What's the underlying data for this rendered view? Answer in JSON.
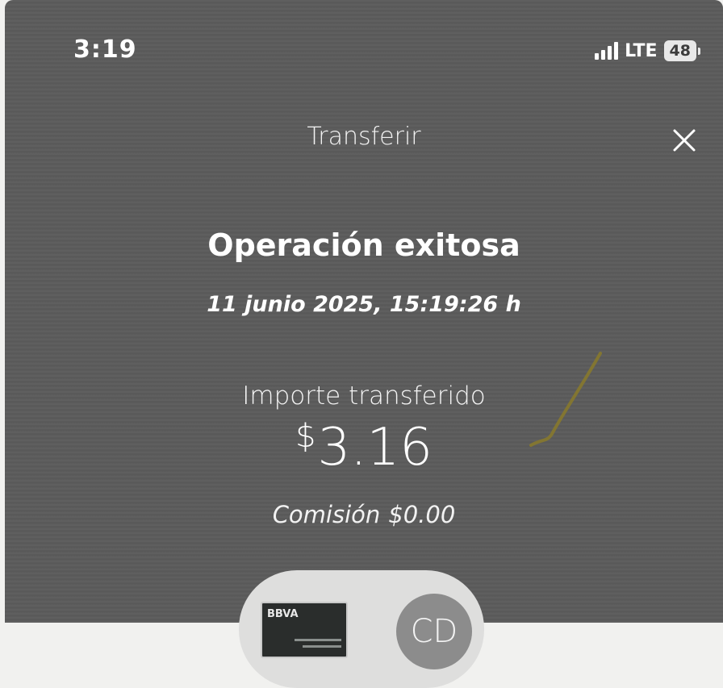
{
  "status_bar": {
    "time": "3:19",
    "network": "LTE",
    "battery": "48"
  },
  "header": {
    "title": "Transferir",
    "close_icon": "close-icon"
  },
  "result": {
    "heading": "Operación exitosa",
    "datetime": "11 junio 2025, 15:19:26 h",
    "amount_label": "Importe transferido",
    "amount_currency": "$",
    "amount_value": "3.16",
    "commission_label": "Comisión",
    "commission_value": "$0.00"
  },
  "parties": {
    "source_card_brand": "BBVA",
    "recipient_initials": "CD"
  },
  "colors": {
    "screen_background": "#5b5b5b",
    "text": "#ffffff",
    "pill": "#dededd",
    "avatar": "#8c8c8c"
  }
}
